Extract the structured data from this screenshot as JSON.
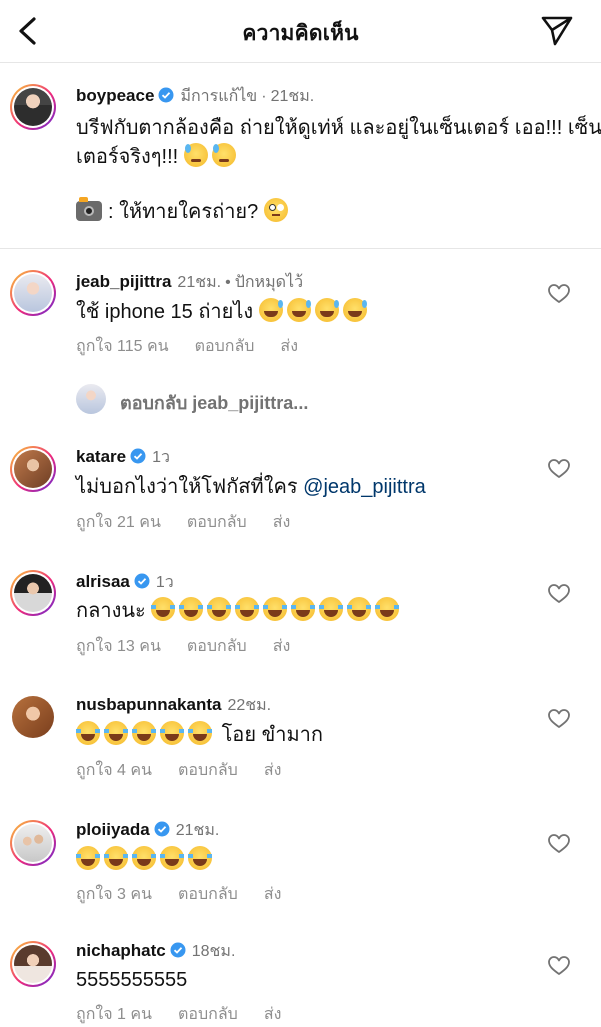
{
  "header": {
    "title": "ความคิดเห็น",
    "back_icon": "chevron-left-icon",
    "share_icon": "paper-plane-icon"
  },
  "caption": {
    "username": "boypeace",
    "edited": "มีการแก้ไข",
    "time": "21ชม.",
    "line1": "บรีฟกับตากล้องคือ ถ่ายให้ดูเท่ห์ และอยู่ในเซ็นเตอร์ เออ!!! เซ็น",
    "line2": "เตอร์จริงๆ!!!",
    "line3": ": ให้ทายใครถ่าย?"
  },
  "comments": [
    {
      "username": "jeab_pijittra",
      "time": "21ชม.",
      "pinned": "ปักหมุดไว้",
      "text": "ใช้ iphone 15 ถ่ายไง",
      "likes": "ถูกใจ 115 คน",
      "reply": "ตอบกลับ",
      "send": "ส่ง"
    },
    {
      "username": "katare",
      "time": "1ว",
      "text": "ไม่บอกไงว่าให้โฟกัสที่ใคร",
      "mention": "@jeab_pijittra",
      "likes": "ถูกใจ 21 คน",
      "reply": "ตอบกลับ",
      "send": "ส่ง"
    },
    {
      "username": "alrisaa",
      "time": "1ว",
      "text": "กลางนะ",
      "likes": "ถูกใจ 13 คน",
      "reply": "ตอบกลับ",
      "send": "ส่ง"
    },
    {
      "username": "nusbapunnakanta",
      "time": "22ชม.",
      "text": "โอย ขำมาก",
      "likes": "ถูกใจ 4 คน",
      "reply": "ตอบกลับ",
      "send": "ส่ง"
    },
    {
      "username": "ploiiyada",
      "time": "21ชม.",
      "text": "",
      "likes": "ถูกใจ 3 คน",
      "reply": "ตอบกลับ",
      "send": "ส่ง"
    },
    {
      "username": "nichaphatc",
      "time": "18ชม.",
      "text": "5555555555",
      "likes": "ถูกใจ 1 คน",
      "reply": "ตอบกลับ",
      "send": "ส่ง"
    }
  ],
  "reply_thread": {
    "label": "ตอบกลับ jeab_pijittra..."
  },
  "colors": {
    "verified": "#3897f0",
    "mention": "#00376b",
    "meta": "#737373"
  }
}
